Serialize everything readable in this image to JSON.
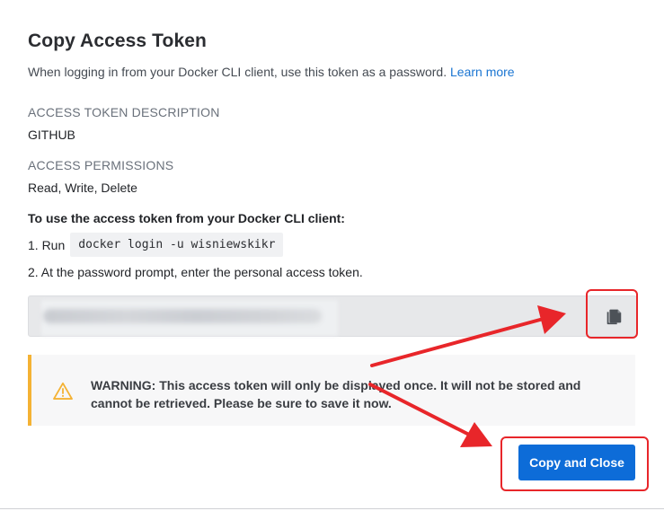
{
  "dialog": {
    "title": "Copy Access Token",
    "subtitle": "When logging in from your Docker CLI client, use this token as a password.",
    "learn_more": "Learn more"
  },
  "description": {
    "label": "ACCESS TOKEN DESCRIPTION",
    "value": "GITHUB"
  },
  "permissions": {
    "label": "ACCESS PERMISSIONS",
    "value": "Read, Write, Delete"
  },
  "instructions": {
    "title": "To use the access token from your Docker CLI client:",
    "step1_prefix": "1. Run",
    "step1_code": "docker login -u wisniewskikr",
    "step2": "2. At the password prompt, enter the personal access token."
  },
  "token": {
    "copy_icon": "copy-icon"
  },
  "warning": {
    "icon": "warning-icon",
    "text": "WARNING: This access token will only be displayed once. It will not be stored and cannot be retrieved. Please be sure to save it now."
  },
  "actions": {
    "copy_close_label": "Copy and Close"
  },
  "colors": {
    "primary": "#0d6cd8",
    "link": "#1a75d2",
    "warning_accent": "#f4b234",
    "annotation_red": "#e8262a"
  }
}
